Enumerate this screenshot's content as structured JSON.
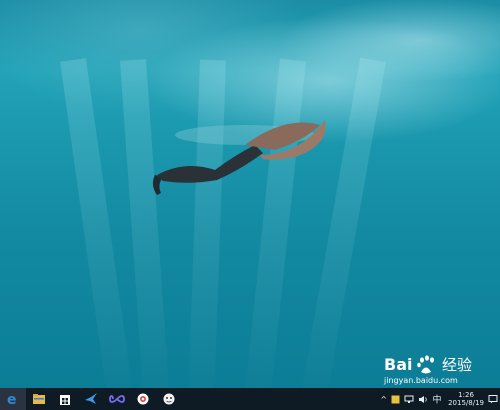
{
  "desktop": {
    "wallpaper": "underwater-freediver"
  },
  "taskbar": {
    "apps": [
      {
        "name": "edge-icon",
        "active": true
      },
      {
        "name": "file-explorer-icon",
        "active": false
      },
      {
        "name": "store-icon",
        "active": false
      },
      {
        "name": "bird-app-icon",
        "active": false
      },
      {
        "name": "infinity-app-icon",
        "active": false
      },
      {
        "name": "browser-app-icon",
        "active": false
      },
      {
        "name": "chat-app-icon",
        "active": false
      }
    ],
    "tray": {
      "chevron": "^",
      "time": "1:26",
      "date": "2015/8/19"
    }
  },
  "watermark": {
    "brand": "Bai",
    "brand2": "经验",
    "url": "jingyan.baidu.com"
  },
  "colors": {
    "taskbar": "#0e1a24",
    "edge": "#2e88d8",
    "water": "#1b98ae"
  }
}
